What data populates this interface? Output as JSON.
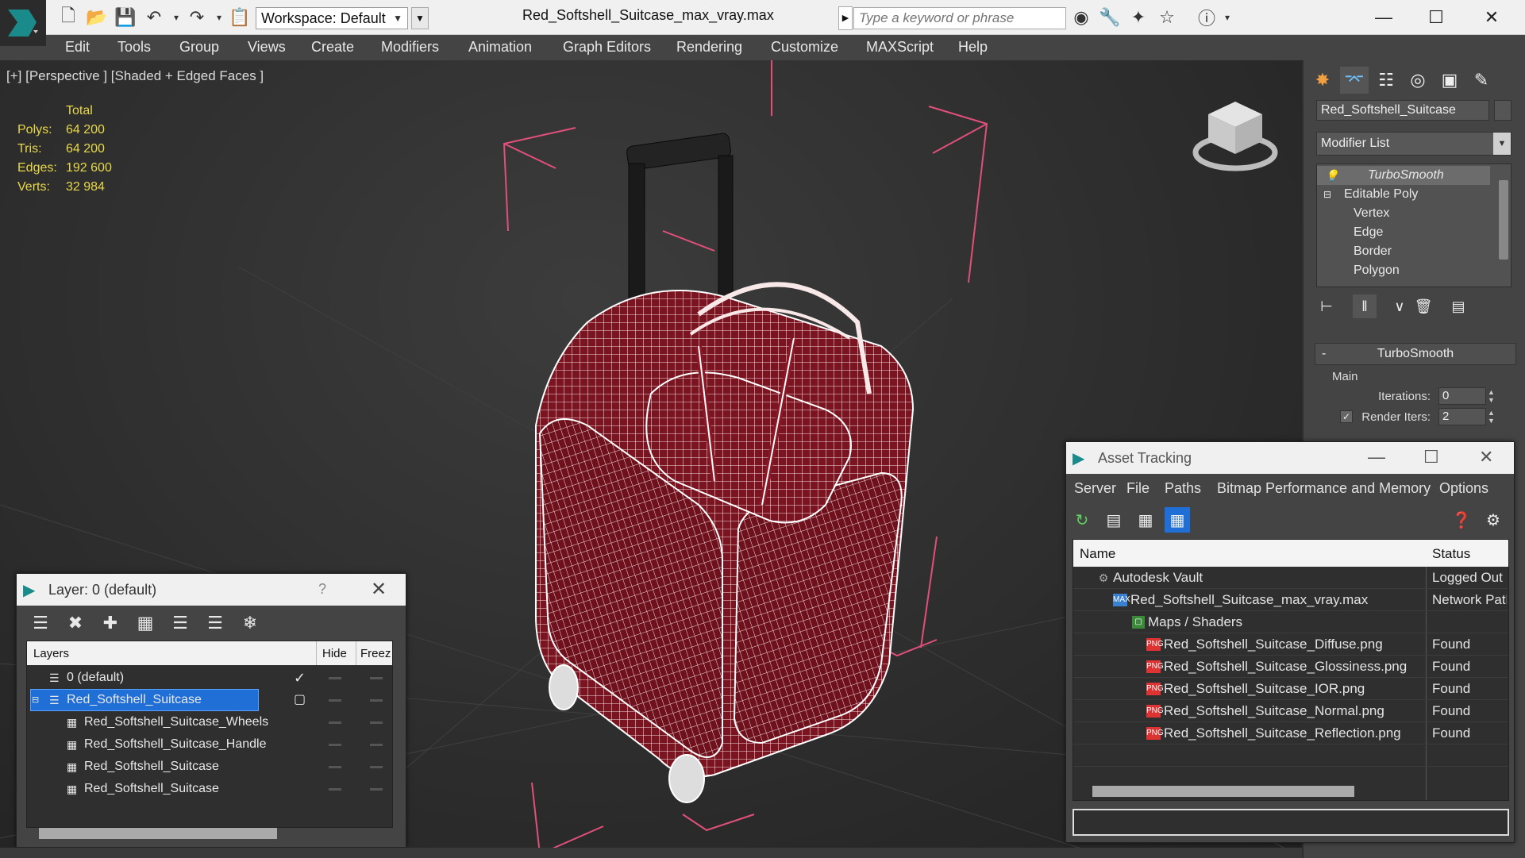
{
  "titlebar": {
    "workspace": "Workspace: Default",
    "document_title": "Red_Softshell_Suitcase_max_vray.max",
    "search_placeholder": "Type a keyword or phrase",
    "icons": [
      "new-file-icon",
      "open-icon",
      "save-icon",
      "undo-icon",
      "redo-icon",
      "project-icon",
      "binoculars-icon",
      "tools-icon",
      "communication-icon",
      "favorites-icon",
      "help-icon"
    ]
  },
  "menubar": {
    "items": [
      "Edit",
      "Tools",
      "Group",
      "Views",
      "Create",
      "Modifiers",
      "Animation",
      "Graph Editors",
      "Rendering",
      "Customize",
      "MAXScript",
      "Help"
    ]
  },
  "viewport": {
    "label": "[+] [Perspective ] [Shaded + Edged Faces ]",
    "stats": {
      "header": "Total",
      "rows": [
        {
          "label": "Polys:",
          "value": "64 200"
        },
        {
          "label": "Tris:",
          "value": "64 200"
        },
        {
          "label": "Edges:",
          "value": "192 600"
        },
        {
          "label": "Verts:",
          "value": "32 984"
        }
      ]
    },
    "colors": {
      "wire": "#ffffff",
      "surface": "#7a1420",
      "bbox": "#e0507a"
    }
  },
  "command_panel": {
    "object_name": "Red_Softshell_Suitcase",
    "modifier_list": "Modifier List",
    "stack": [
      {
        "label": "TurboSmooth",
        "level": 0,
        "selected": true
      },
      {
        "label": "Editable Poly",
        "level": 0,
        "selected": false
      },
      {
        "label": "Vertex",
        "level": 1,
        "selected": false
      },
      {
        "label": "Edge",
        "level": 1,
        "selected": false
      },
      {
        "label": "Border",
        "level": 1,
        "selected": false
      },
      {
        "label": "Polygon",
        "level": 1,
        "selected": false
      }
    ],
    "rollout": {
      "title": "TurboSmooth",
      "collapse": "-",
      "group": "Main",
      "iterations_label": "Iterations:",
      "iterations_value": "0",
      "render_iters_label": "Render Iters:",
      "render_iters_value": "2"
    }
  },
  "layer_window": {
    "title": "Layer: 0 (default)",
    "help": "?",
    "columns": {
      "layers": "Layers",
      "hide": "Hide",
      "freeze": "Freez"
    },
    "rows": [
      {
        "name": "0 (default)",
        "indent": 1,
        "type": "layer",
        "selected": false
      },
      {
        "name": "Red_Softshell_Suitcase",
        "indent": 1,
        "type": "layer",
        "selected": true
      },
      {
        "name": "Red_Softshell_Suitcase_Wheels",
        "indent": 2,
        "type": "object",
        "selected": false
      },
      {
        "name": "Red_Softshell_Suitcase_Handle",
        "indent": 2,
        "type": "object",
        "selected": false
      },
      {
        "name": "Red_Softshell_Suitcase",
        "indent": 2,
        "type": "object",
        "selected": false
      },
      {
        "name": "Red_Softshell_Suitcase",
        "indent": 2,
        "type": "object",
        "selected": false
      }
    ]
  },
  "asset_window": {
    "title": "Asset Tracking",
    "menu": [
      "Server",
      "File",
      "Paths",
      "Bitmap Performance and Memory",
      "Options"
    ],
    "columns": {
      "name": "Name",
      "status": "Status"
    },
    "rows": [
      {
        "name": "Autodesk Vault",
        "status": "Logged Out ...",
        "indent": 1,
        "icon": "vault"
      },
      {
        "name": "Red_Softshell_Suitcase_max_vray.max",
        "status": "Network Path",
        "indent": 2,
        "icon": "max"
      },
      {
        "name": "Maps / Shaders",
        "status": "",
        "indent": 3,
        "icon": "maps"
      },
      {
        "name": "Red_Softshell_Suitcase_Diffuse.png",
        "status": "Found",
        "indent": 4,
        "icon": "png"
      },
      {
        "name": "Red_Softshell_Suitcase_Glossiness.png",
        "status": "Found",
        "indent": 4,
        "icon": "png"
      },
      {
        "name": "Red_Softshell_Suitcase_IOR.png",
        "status": "Found",
        "indent": 4,
        "icon": "png"
      },
      {
        "name": "Red_Softshell_Suitcase_Normal.png",
        "status": "Found",
        "indent": 4,
        "icon": "png"
      },
      {
        "name": "Red_Softshell_Suitcase_Reflection.png",
        "status": "Found",
        "indent": 4,
        "icon": "png"
      }
    ]
  }
}
